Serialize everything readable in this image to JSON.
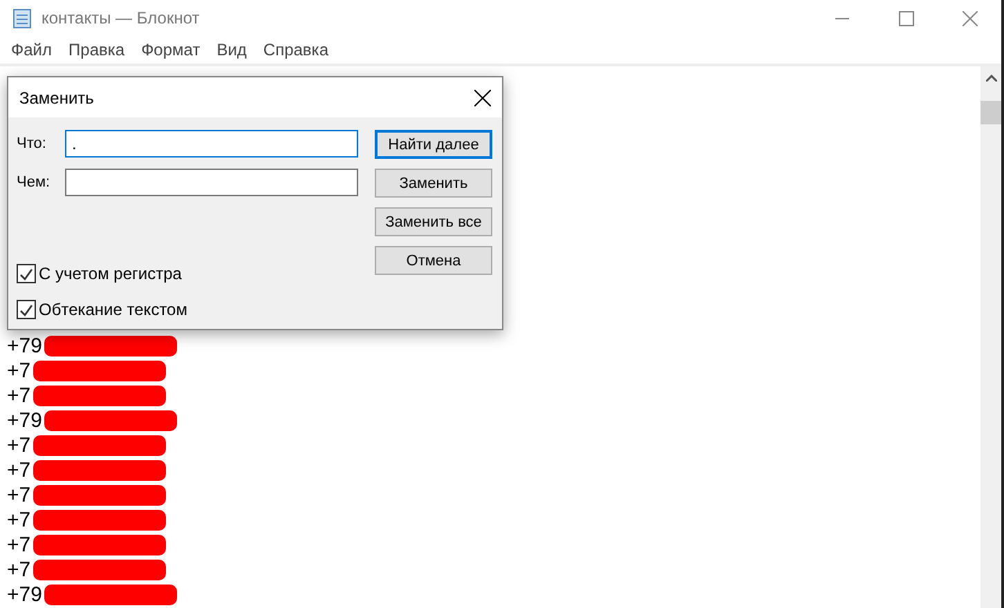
{
  "window": {
    "title": "контакты — Блокнот"
  },
  "menu": [
    "Файл",
    "Правка",
    "Формат",
    "Вид",
    "Справка"
  ],
  "lines": [
    {
      "text": "+79"
    },
    {
      "text": "+7"
    },
    {
      "text": "+7"
    },
    {
      "text": "+79"
    },
    {
      "text": "+7"
    },
    {
      "text": "+7"
    },
    {
      "text": "+7"
    },
    {
      "text": "+7"
    },
    {
      "text": "+7"
    },
    {
      "text": "+7"
    },
    {
      "text": "+79"
    }
  ],
  "dialog": {
    "title": "Заменить",
    "find_label": "Что:",
    "find_value": ".",
    "replace_label": "Чем:",
    "buttons": [
      {
        "label": "Найти далее",
        "selected": true
      },
      {
        "label": "Заменить",
        "selected": false
      },
      {
        "label": "Заменить все",
        "selected": false
      },
      {
        "label": "Отмена",
        "selected": false
      }
    ],
    "options": [
      {
        "label": "С учетом регистра",
        "checked": true
      },
      {
        "label": "Обтекание текстом",
        "checked": true
      }
    ]
  }
}
